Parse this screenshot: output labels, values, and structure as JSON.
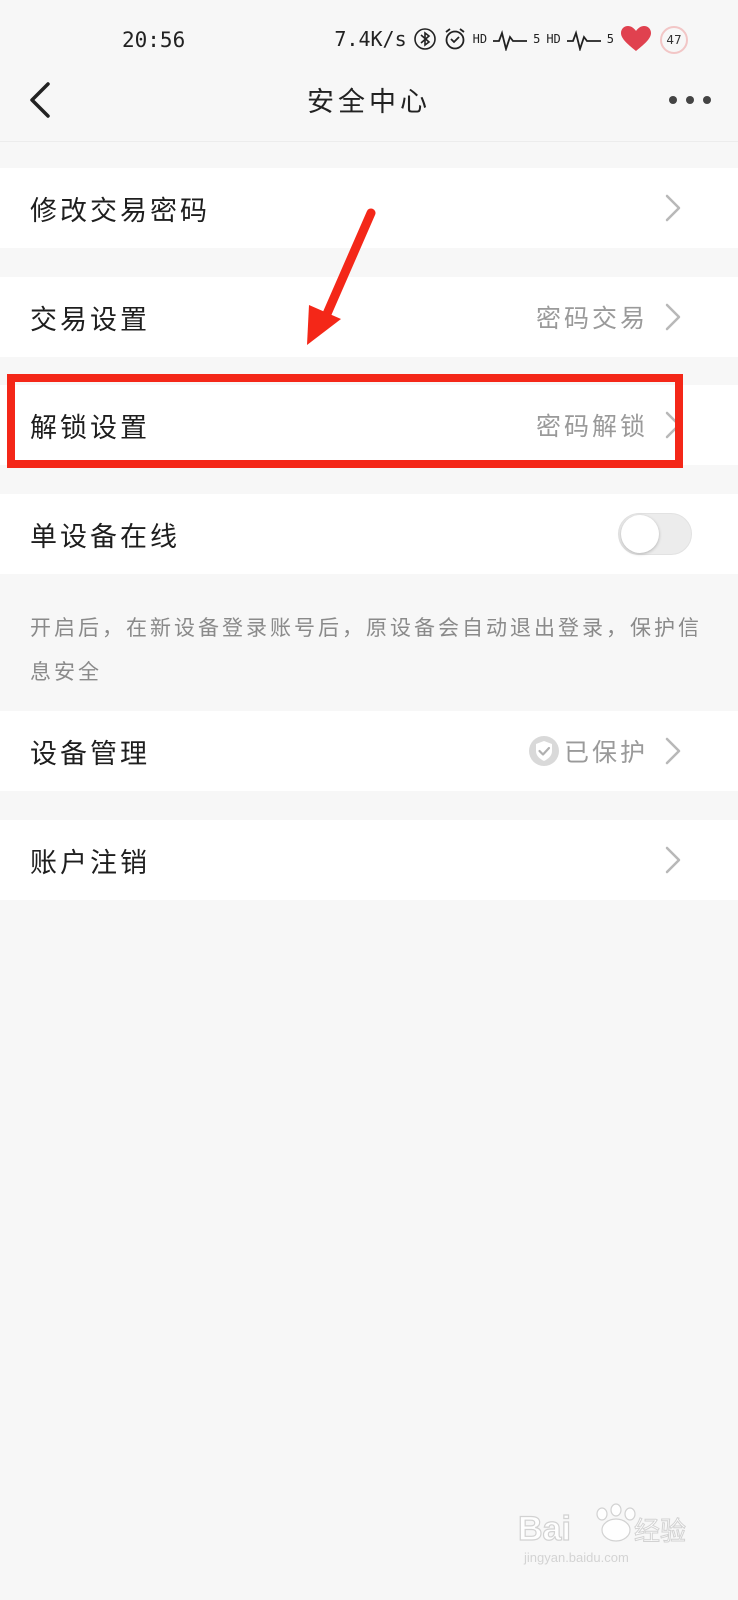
{
  "status_bar": {
    "time": "20:56",
    "net_speed": "7.4K/s",
    "signal_label_1": "HD",
    "signal_num_1": "5",
    "signal_label_2": "HD",
    "signal_num_2": "5",
    "battery": "47",
    "icons": [
      "bluetooth-icon",
      "alarm-icon",
      "signal-icon",
      "signal-icon",
      "heart-icon"
    ]
  },
  "nav": {
    "title": "安全中心",
    "back_icon": "back-chevron-icon",
    "more_icon": "more-dots-icon"
  },
  "rows": [
    {
      "label": "修改交易密码",
      "value": ""
    },
    {
      "label": "交易设置",
      "value": "密码交易"
    },
    {
      "label": "解锁设置",
      "value": "密码解锁"
    },
    {
      "label": "单设备在线",
      "toggle_on": false
    },
    {
      "label": "设备管理",
      "value": "已保护",
      "icon": "shield-check-icon"
    },
    {
      "label": "账户注销",
      "value": ""
    }
  ],
  "single_device_note": "开启后，在新设备登录账号后，原设备会自动退出登录，保护信息安全",
  "colors": {
    "annotation_red": "#f42718",
    "background": "#f7f7f7",
    "row_bg": "#ffffff",
    "value_gray": "#9a9a9a"
  },
  "watermark": {
    "brand": "Bai",
    "brand_tail": "经验",
    "url": "jingyan.baidu.com"
  }
}
